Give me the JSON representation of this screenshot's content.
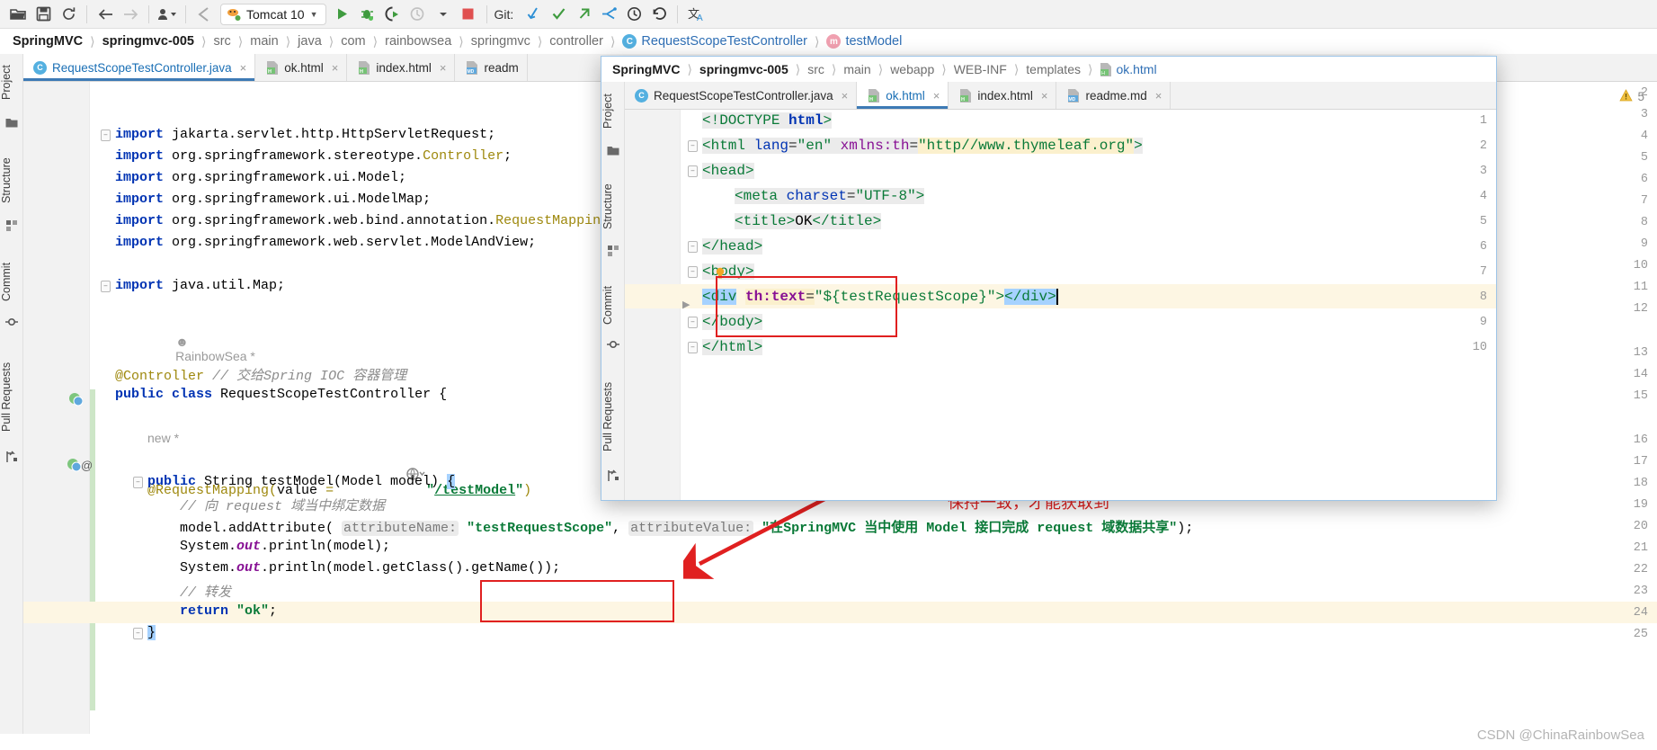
{
  "toolbar": {
    "icons": [
      "open-folder-icon",
      "save-icon",
      "sync-icon",
      "back-arrow-icon",
      "forward-arrow-icon",
      "profile-dropdown-icon",
      "undo-arrow-icon"
    ],
    "run_config": {
      "label": "Tomcat 10",
      "icon": "tomcat-icon",
      "chevron": "▼"
    },
    "run_icons": [
      "run-icon",
      "debug-icon",
      "run-with-coverage-icon",
      "profile-icon",
      "stop-icon"
    ],
    "git_label": "Git:",
    "git_icons": [
      "git-update-icon",
      "git-commit-icon",
      "git-push-icon",
      "git-rebase-icon",
      "git-history-icon",
      "git-rollback-icon"
    ],
    "translate_icon": "translate-icon"
  },
  "main_breadcrumb": [
    {
      "text": "SpringMVC",
      "style": "bold"
    },
    {
      "text": "springmvc-005",
      "style": "bold"
    },
    {
      "text": "src",
      "style": "plain"
    },
    {
      "text": "main",
      "style": "plain"
    },
    {
      "text": "java",
      "style": "plain"
    },
    {
      "text": "com",
      "style": "plain"
    },
    {
      "text": "rainbowsea",
      "style": "plain"
    },
    {
      "text": "springmvc",
      "style": "plain"
    },
    {
      "text": "controller",
      "style": "plain"
    },
    {
      "text": "RequestScopeTestController",
      "style": "link",
      "icon": "class-icon",
      "icon_letter": "C"
    },
    {
      "text": "testModel",
      "style": "link",
      "icon": "method-icon",
      "icon_letter": "m"
    }
  ],
  "left_toolstrip": [
    {
      "label": "Project",
      "icon": "project-folder-icon"
    },
    {
      "label": "Structure",
      "icon": "structure-icon"
    },
    {
      "label": "Commit",
      "icon": "commit-icon"
    },
    {
      "label": "Pull Requests",
      "icon": "pull-requests-icon"
    }
  ],
  "main_tabs": [
    {
      "label": "RequestScopeTestController.java",
      "icon": "java-class-icon",
      "active": true,
      "close": "×"
    },
    {
      "label": "ok.html",
      "icon": "html-file-icon",
      "active": false,
      "close": "×"
    },
    {
      "label": "index.html",
      "icon": "html-file-icon",
      "active": false,
      "close": "×"
    },
    {
      "label": "readm",
      "icon": "markdown-file-icon",
      "active": false,
      "close": "×"
    }
  ],
  "warning_badge": {
    "icon": "warning-triangle-icon",
    "count": "5"
  },
  "main_editor": {
    "lines": [
      {
        "n": "2",
        "text": ""
      },
      {
        "n": "3",
        "text": ""
      },
      {
        "n": "4",
        "text": "import jakarta.servlet.http.HttpServletRequest;"
      },
      {
        "n": "5",
        "text": "import org.springframework.stereotype.Controller;"
      },
      {
        "n": "6",
        "text": "import org.springframework.ui.Model;"
      },
      {
        "n": "7",
        "text": "import org.springframework.ui.ModelMap;"
      },
      {
        "n": "8",
        "text": "import org.springframework.web.bind.annotation.RequestMapping;"
      },
      {
        "n": "9",
        "text": "import org.springframework.web.servlet.ModelAndView;"
      },
      {
        "n": "10",
        "text": ""
      },
      {
        "n": "11",
        "text": "import java.util.Map;"
      },
      {
        "n": "12",
        "text": ""
      },
      {
        "n": "",
        "text": "RainbowSea *",
        "kind": "inlay-author"
      },
      {
        "n": "13",
        "text": "@Controller // 交给Spring IOC 容器管理"
      },
      {
        "n": "14",
        "text": "public class RequestScopeTestController {"
      },
      {
        "n": "15",
        "text": ""
      },
      {
        "n": "",
        "text": "new *",
        "kind": "inlay-new"
      },
      {
        "n": "16",
        "text": "@RequestMapping(value = \"/testModel\")"
      },
      {
        "n": "17",
        "text": "public String testModel(Model model) {"
      },
      {
        "n": "18",
        "text": "    // 向 request 域当中绑定数据"
      },
      {
        "n": "19",
        "text": "    model.addAttribute( attributeName: \"testRequestScope\", attributeValue: \"在SpringMVC 当中使用 Model 接口完成 request 域数据共享\");"
      },
      {
        "n": "20",
        "text": "    System.out.println(model);"
      },
      {
        "n": "21",
        "text": "    System.out.println(model.getClass().getName());"
      },
      {
        "n": "22",
        "text": "    // 转发"
      },
      {
        "n": "23",
        "text": "    return \"ok\";"
      },
      {
        "n": "24",
        "text": "}"
      },
      {
        "n": "25",
        "text": ""
      }
    ],
    "inlay_author": "RainbowSea *",
    "inlay_new": "new *",
    "annotation_param_name": "attributeName:",
    "annotation_param_value": "attributeValue:",
    "attr_name_literal": "\"testRequestScope\"",
    "attr_value_literal": "\"在SpringMVC 当中使用 Model 接口完成 request 域数据共享\""
  },
  "popup": {
    "breadcrumb": [
      {
        "text": "SpringMVC",
        "style": "bold"
      },
      {
        "text": "springmvc-005",
        "style": "bold"
      },
      {
        "text": "src",
        "style": "plain"
      },
      {
        "text": "main",
        "style": "plain"
      },
      {
        "text": "webapp",
        "style": "plain"
      },
      {
        "text": "WEB-INF",
        "style": "plain"
      },
      {
        "text": "templates",
        "style": "plain"
      },
      {
        "text": "ok.html",
        "style": "link",
        "icon": "html-file-icon"
      }
    ],
    "toolstrip": [
      {
        "label": "Project",
        "icon": "project-folder-icon"
      },
      {
        "label": "Structure",
        "icon": "structure-icon"
      },
      {
        "label": "Commit",
        "icon": "commit-icon"
      },
      {
        "label": "Pull Requests",
        "icon": "pull-requests-icon"
      }
    ],
    "tabs": [
      {
        "label": "RequestScopeTestController.java",
        "icon": "java-class-icon",
        "active": false,
        "close": "×"
      },
      {
        "label": "ok.html",
        "icon": "html-file-icon",
        "active": true,
        "close": "×"
      },
      {
        "label": "index.html",
        "icon": "html-file-icon",
        "active": false,
        "close": "×"
      },
      {
        "label": "readme.md",
        "icon": "markdown-file-icon",
        "active": false,
        "close": "×"
      }
    ],
    "lines": [
      {
        "n": "1",
        "text": "<!DOCTYPE html>"
      },
      {
        "n": "2",
        "text": "<html lang=\"en\" xmlns:th=\"http//www.thymeleaf.org\">"
      },
      {
        "n": "3",
        "text": "<head>"
      },
      {
        "n": "4",
        "text": "    <meta charset=\"UTF-8\">"
      },
      {
        "n": "5",
        "text": "    <title>OK</title>"
      },
      {
        "n": "6",
        "text": "</head>"
      },
      {
        "n": "7",
        "text": "<body>"
      },
      {
        "n": "8",
        "text": "<div th:text=\"${testRequestScope}\"></div>"
      },
      {
        "n": "9",
        "text": "</body>"
      },
      {
        "n": "10",
        "text": "</html>"
      }
    ]
  },
  "annotations": {
    "note_text": "保持一致，才能获取到",
    "note_color": "#e02020",
    "box_color": "#e02020",
    "arrow_color": "#e02020"
  },
  "watermark": "CSDN @ChinaRainbowSea",
  "colors": {
    "accent_blue": "#2f6fb5",
    "keyword_blue": "#0033b3",
    "string_green": "#0a7a38",
    "annotation_gold": "#9e880d",
    "comment_gray": "#8c8c8c",
    "highlight_line": "#fdf6e3",
    "selection_blue": "#a6d2ff",
    "red_annotation": "#e02020"
  }
}
